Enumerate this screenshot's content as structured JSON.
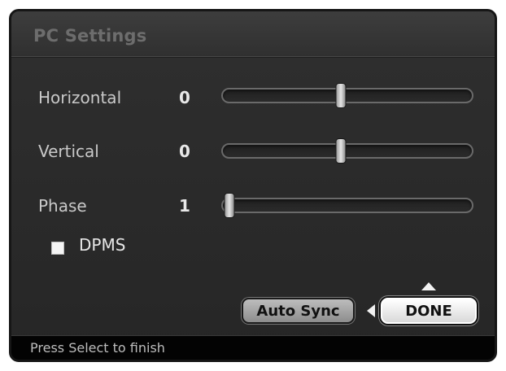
{
  "window": {
    "title": "PC Settings"
  },
  "settings": [
    {
      "label": "Horizontal",
      "value": "0",
      "level": 0.5
    },
    {
      "label": "Vertical",
      "value": "0",
      "level": 0.5
    },
    {
      "label": "Phase",
      "value": "1",
      "level": 0.0
    }
  ],
  "dpms": {
    "label": "DPMS",
    "checked": false
  },
  "buttons": {
    "auto_sync": "Auto Sync",
    "done": "DONE"
  },
  "status": {
    "text": "Press Select to finish"
  },
  "colors": {
    "panel": "#2b2b2b",
    "text": "#c9c9c9",
    "button_focus": "#ffffff"
  }
}
